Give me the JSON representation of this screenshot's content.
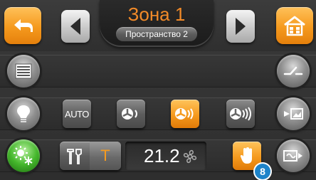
{
  "header": {
    "zone_title": "Зона 1",
    "space_name": "Пространство 2"
  },
  "colors": {
    "accent_orange": "#f59a1e",
    "title_orange": "#f28a28",
    "badge_blue": "#1d83c9"
  },
  "icons": {
    "back": "back-arrow-icon",
    "prev": "chevron-left-icon",
    "next": "chevron-right-icon",
    "home": "home-icon"
  },
  "fan_modes": {
    "auto_label": "AUTO",
    "selected": "medium"
  },
  "controls": {
    "mode_letter": "T",
    "temperature": "21.2",
    "badge_count": "8"
  }
}
